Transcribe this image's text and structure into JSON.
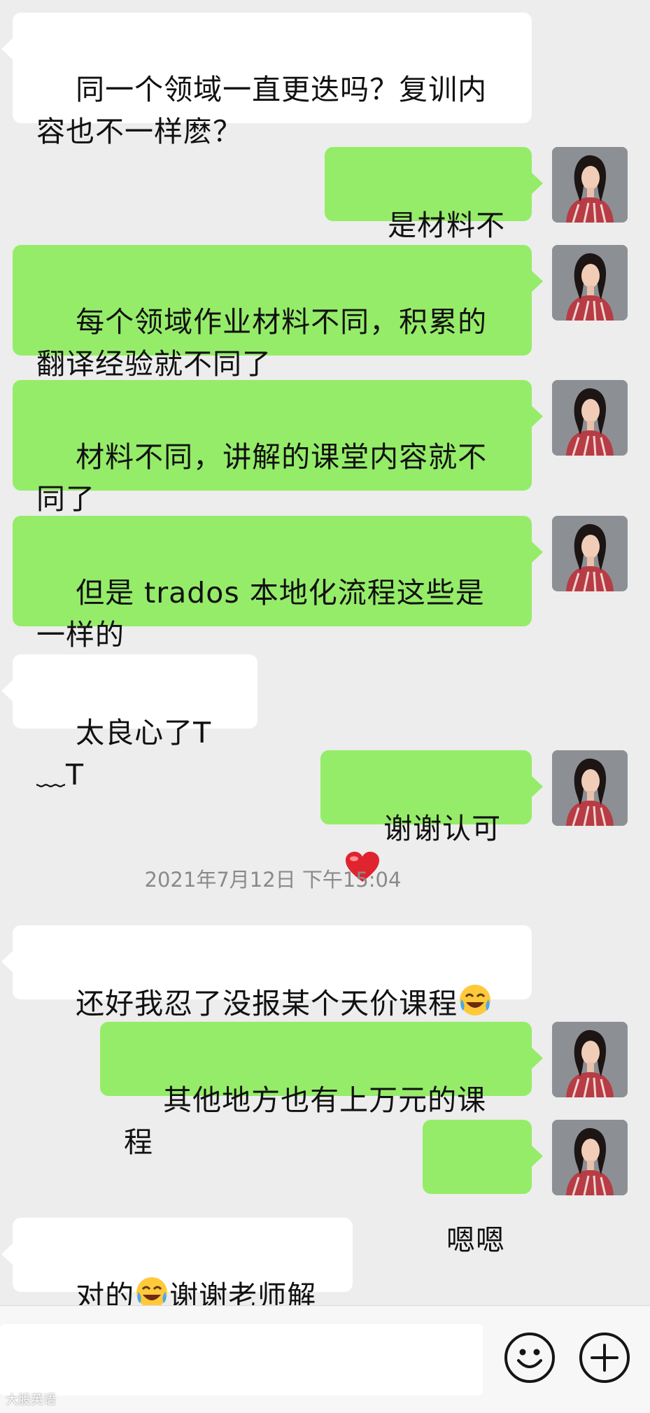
{
  "messages": [
    {
      "dir": "in",
      "text": "同一个领域一直更迭吗？复训内容也不一样麽？"
    },
    {
      "dir": "out",
      "text": "是材料不同"
    },
    {
      "dir": "out",
      "text": "每个领域作业材料不同，积累的翻译经验就不同了"
    },
    {
      "dir": "out",
      "text": "材料不同，讲解的课堂内容就不同了"
    },
    {
      "dir": "out",
      "text": "但是 trados 本地化流程这些是一样的"
    },
    {
      "dir": "in",
      "text": "太良心了T﹏T"
    },
    {
      "dir": "out",
      "text": "谢谢认可",
      "emoji": "heart"
    },
    {
      "dir": "in",
      "text": "还好我忍了没报某个天价课程",
      "emoji": "tears-of-joy"
    },
    {
      "dir": "out",
      "text": "其他地方也有上万元的课程"
    },
    {
      "dir": "out",
      "text": "嗯嗯"
    },
    {
      "dir": "in",
      "text_before": "对的",
      "emoji": "tears-of-joy",
      "text_after": "谢谢老师解答"
    }
  ],
  "timestamp": "2021年7月12日 下午15:04",
  "bottom_bar": {
    "emoji_button_icon": "smiley-icon",
    "plus_button_icon": "plus-icon"
  },
  "watermark": "大股英语",
  "colors": {
    "background": "#ededed",
    "incoming_bubble": "#ffffff",
    "outgoing_bubble": "#95ec69",
    "timestamp_text": "#8a8a8a"
  }
}
